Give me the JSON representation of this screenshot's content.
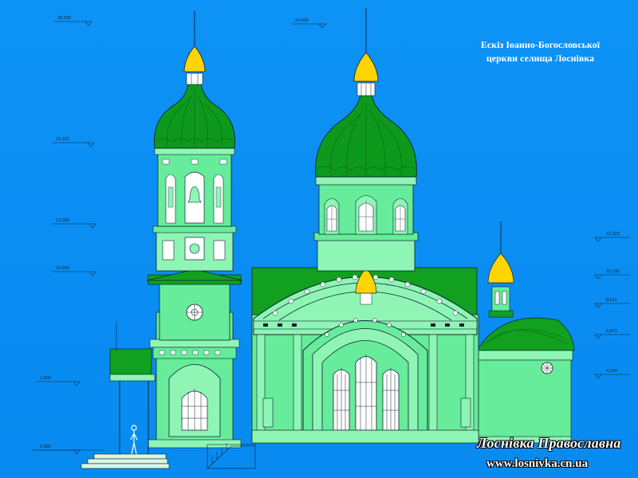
{
  "caption": {
    "line1": "Ескіз Іоанно-Богословської",
    "line2": "церкви селища Лоснівка"
  },
  "brand": {
    "name": "Лоснівка Православна",
    "url": "www.losnivka.cn.ua"
  },
  "elevation_marks": {
    "left": [
      "26,025",
      "15,110",
      "13,355",
      "10,265",
      "3,905",
      "0,000"
    ],
    "center": [
      "24,000"
    ],
    "right": [
      "12,225",
      "10,195",
      "8,512",
      "6,670",
      "4,100"
    ]
  },
  "colors": {
    "sky": "#0a8ff4",
    "wall": "#66ec9a",
    "wall_light": "#8ff5b5",
    "roof": "#11a020",
    "dome": "#0d9a1c",
    "gold": "#ffd400",
    "outline": "#123"
  }
}
